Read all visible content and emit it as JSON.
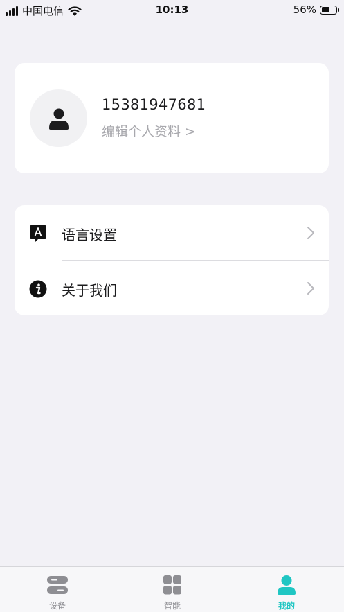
{
  "status_bar": {
    "carrier": "中国电信",
    "time": "10:13",
    "battery": "56%",
    "battery_level": 0.56
  },
  "profile": {
    "phone": "15381947681",
    "edit_label": "编辑个人资料 >"
  },
  "settings": {
    "items": [
      {
        "label": "语言设置",
        "icon": "language-icon"
      },
      {
        "label": "关于我们",
        "icon": "info-icon"
      }
    ]
  },
  "tab_bar": {
    "active_color": "#1fc6c3",
    "tabs": [
      {
        "label": "设备",
        "icon": "device-icon"
      },
      {
        "label": "智能",
        "icon": "smart-grid-icon"
      },
      {
        "label": "我的",
        "icon": "profile-icon"
      }
    ],
    "active_index": 2
  }
}
